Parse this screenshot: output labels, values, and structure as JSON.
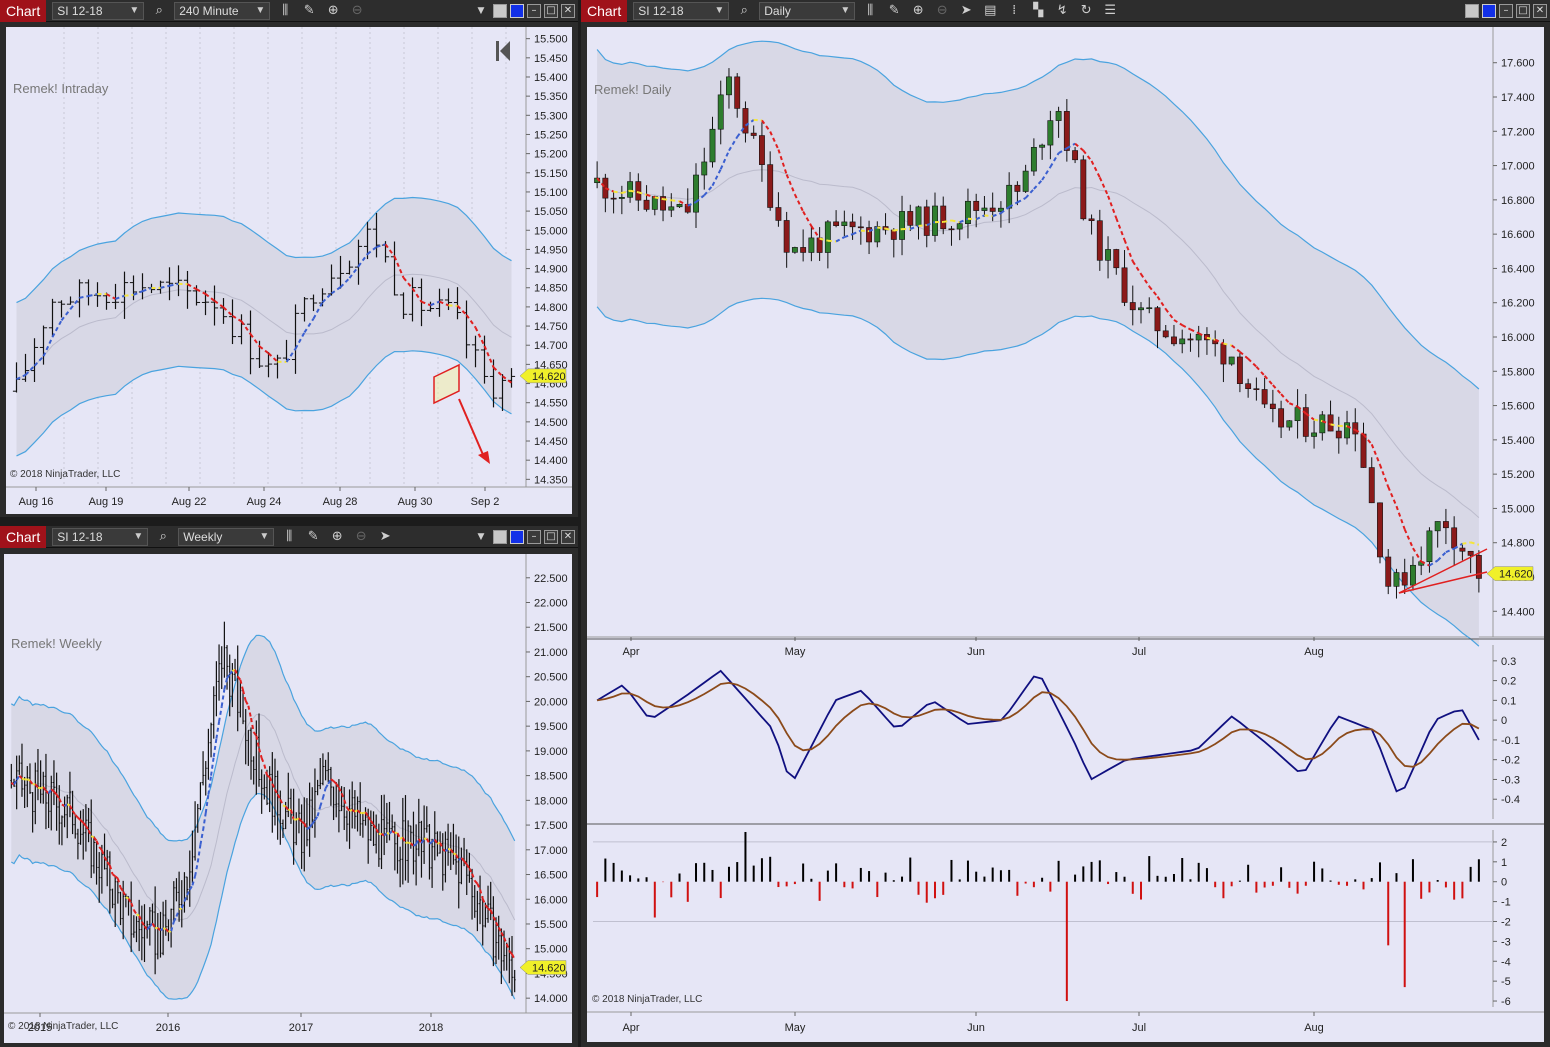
{
  "windows": {
    "intraday": {
      "tab": "Chart",
      "instrument": "SI 12-18",
      "interval": "240 Minute",
      "watermark": "Remek! Intraday",
      "copyright": "© 2018 NinjaTrader, LLC",
      "price_marker": "14.620"
    },
    "daily": {
      "tab": "Chart",
      "instrument": "SI 12-18",
      "interval": "Daily",
      "watermark": "Remek! Daily",
      "copyright": "© 2018 NinjaTrader, LLC",
      "price_marker": "14.620"
    },
    "weekly": {
      "tab": "Chart",
      "instrument": "SI 12-18",
      "interval": "Weekly",
      "watermark": "Remek! Weekly",
      "copyright": "© 2018 NinjaTrader, LLC",
      "price_marker": "14.620"
    }
  },
  "colors": {
    "up": "#2e7d2e",
    "down": "#8b1a1a",
    "band": "#4aa3df",
    "red_ma": "#e02020",
    "yellow_ma": "#f5e63a",
    "blue_ma": "#3a5fd0",
    "osc_fast": "#101080",
    "osc_slow": "#8b4a1a",
    "hist_pos": "#000000",
    "hist_neg": "#d01010",
    "marker": "#f0f02a"
  },
  "chart_data": [
    {
      "type": "candlestick",
      "name_key": "intraday",
      "y_ticks": [
        "15.500",
        "15.450",
        "15.400",
        "15.350",
        "15.300",
        "15.250",
        "15.200",
        "15.150",
        "15.100",
        "15.050",
        "15.000",
        "14.950",
        "14.900",
        "14.850",
        "14.800",
        "14.750",
        "14.700",
        "14.650",
        "14.600",
        "14.550",
        "14.500",
        "14.450",
        "14.400",
        "14.350"
      ],
      "ylim": [
        14.33,
        15.52
      ],
      "x_ticks": [
        "Aug 16",
        "Aug 19",
        "Aug 22",
        "Aug 24",
        "Aug 28",
        "Aug 30",
        "Sep 2"
      ],
      "last": 14.62
    },
    {
      "type": "candlestick",
      "name_key": "daily",
      "y_ticks": [
        "17.600",
        "17.400",
        "17.200",
        "17.000",
        "16.800",
        "16.600",
        "16.400",
        "16.200",
        "16.000",
        "15.800",
        "15.600",
        "15.400",
        "15.200",
        "15.000",
        "14.800",
        "14.600",
        "14.400"
      ],
      "ylim": [
        14.25,
        17.75
      ],
      "x_ticks": [
        "Apr",
        "May",
        "Jun",
        "Jul",
        "Aug"
      ],
      "last": 14.62,
      "osc_ticks": [
        "0.3",
        "0.2",
        "0.1",
        "0",
        "-0.1",
        "-0.2",
        "-0.3",
        "-0.4"
      ],
      "osc_lim": [
        -0.5,
        0.38
      ],
      "hist_ticks": [
        "2",
        "1",
        "0",
        "-1",
        "-2",
        "-3",
        "-4",
        "-5",
        "-6"
      ],
      "hist_lim": [
        -6.3,
        2.6
      ]
    },
    {
      "type": "ohlc",
      "name_key": "weekly",
      "y_ticks": [
        "22.500",
        "22.000",
        "21.500",
        "21.000",
        "20.500",
        "20.000",
        "19.500",
        "19.000",
        "18.500",
        "18.000",
        "17.500",
        "17.000",
        "16.500",
        "16.000",
        "15.500",
        "15.000",
        "14.500",
        "14.000"
      ],
      "ylim": [
        13.7,
        22.9
      ],
      "x_ticks": [
        "2015",
        "2016",
        "2017",
        "2018"
      ],
      "last": 14.62
    }
  ]
}
